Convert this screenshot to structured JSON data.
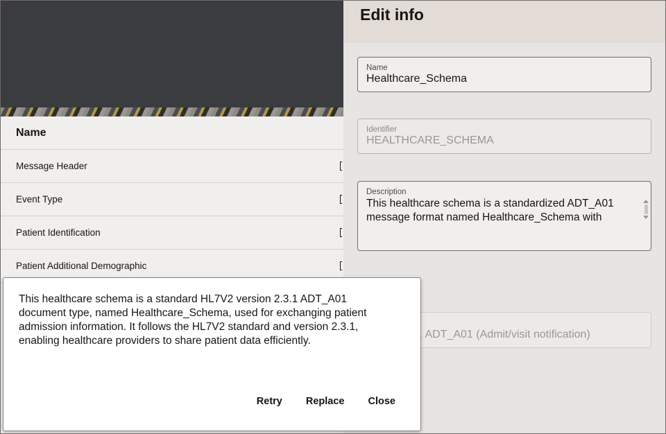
{
  "left_table": {
    "header_name": "Name",
    "rows": [
      {
        "name": "Message Header"
      },
      {
        "name": "Event Type"
      },
      {
        "name": "Patient Identification"
      },
      {
        "name": "Patient Additional Demographic"
      }
    ]
  },
  "drawer": {
    "title": "Edit info",
    "name_field": {
      "label": "Name",
      "value": "Healthcare_Schema"
    },
    "identifier_field": {
      "label": "Identifier",
      "value": "HEALTHCARE_SCHEMA"
    },
    "description_field": {
      "label": "Description",
      "value": "This healthcare schema is a standardized ADT_A01 message format named Healthcare_Schema with"
    },
    "partial_field_value": "1 ADT_A01 (Admit/visit notification)"
  },
  "modal": {
    "text": "This healthcare schema is a standard HL7V2 version 2.3.1 ADT_A01 document type, named Healthcare_Schema, used for exchanging patient admission information. It follows the HL7V2 standard and version 2.3.1, enabling healthcare providers to share patient data efficiently.",
    "buttons": {
      "retry": "Retry",
      "replace": "Replace",
      "close": "Close"
    }
  }
}
